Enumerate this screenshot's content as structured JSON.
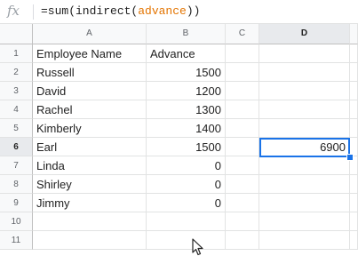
{
  "formula_bar": {
    "fx_label": "fx",
    "prefix": "=sum(indirect(",
    "reference": "advance",
    "suffix": "))",
    "reference_color": "#e37400"
  },
  "columns": [
    "A",
    "B",
    "C",
    "D"
  ],
  "rows": [
    "1",
    "2",
    "3",
    "4",
    "5",
    "6",
    "7",
    "8",
    "9",
    "10",
    "11"
  ],
  "selected_cell": "D6",
  "table": {
    "headers": {
      "name": "Employee Name",
      "advance": "Advance"
    },
    "records": [
      {
        "name": "Russell",
        "advance": "1500"
      },
      {
        "name": "David",
        "advance": "1200"
      },
      {
        "name": "Rachel",
        "advance": "1300"
      },
      {
        "name": "Kimberly",
        "advance": "1400"
      },
      {
        "name": "Earl",
        "advance": "1500"
      },
      {
        "name": "Linda",
        "advance": "0"
      },
      {
        "name": "Shirley",
        "advance": "0"
      },
      {
        "name": "Jimmy",
        "advance": "0"
      }
    ]
  },
  "result_cell": {
    "value": "6900"
  },
  "colors": {
    "selection": "#1a73e8",
    "header_bg": "#f8f9fa",
    "gridline": "#e2e3e3"
  }
}
